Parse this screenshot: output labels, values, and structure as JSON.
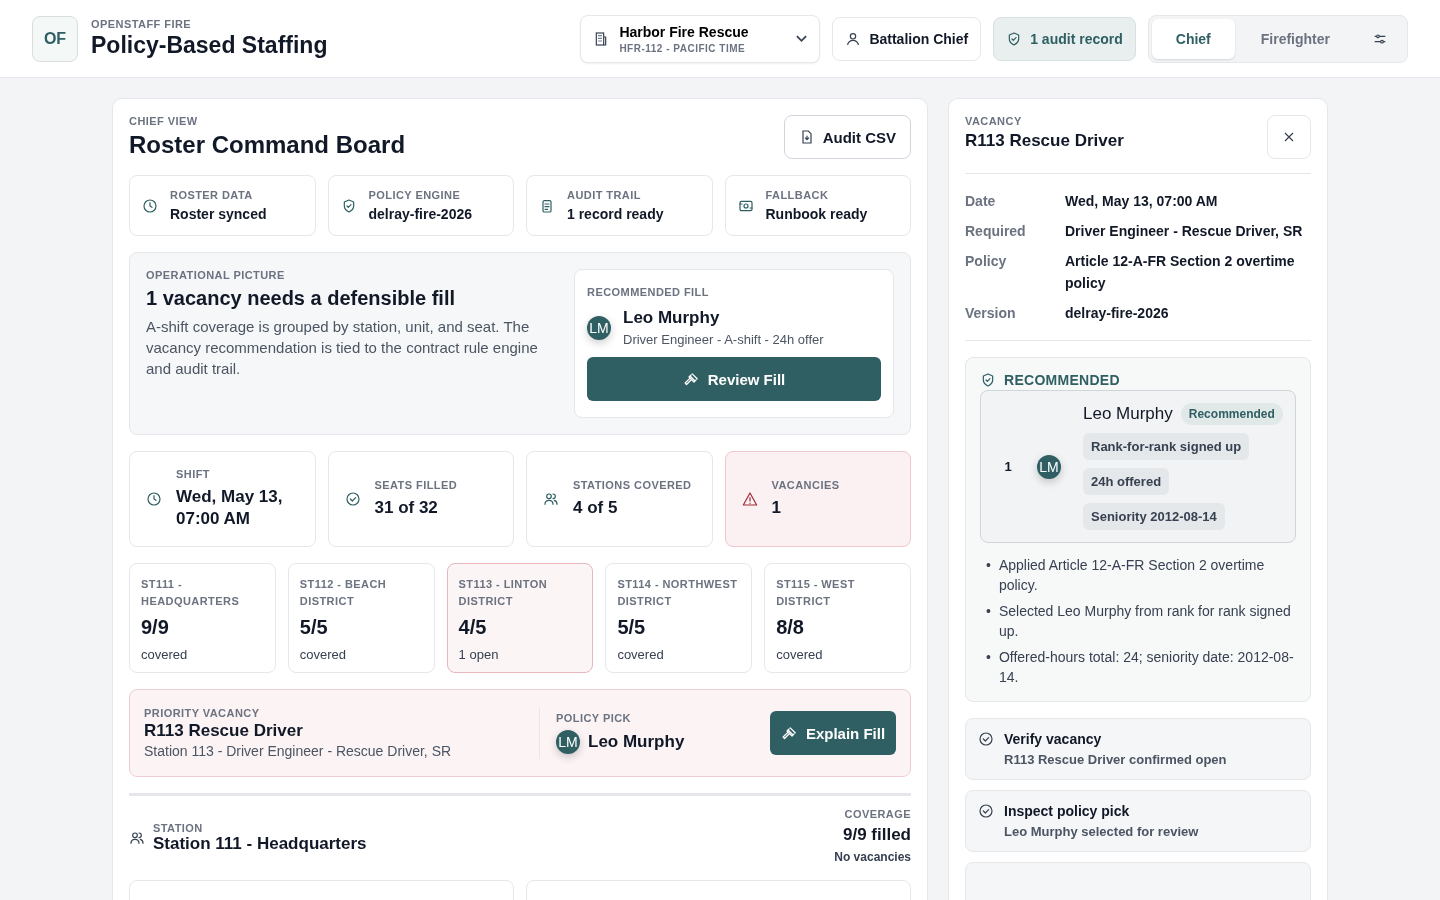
{
  "header": {
    "logo": "OF",
    "org": "OPENSTAFF FIRE",
    "title": "Policy-Based Staffing",
    "agency": {
      "name": "Harbor Fire Rescue",
      "sub": "HFR-112 - PACIFIC TIME"
    },
    "role": "Battalion Chief",
    "audit": "1 audit record",
    "views": [
      {
        "label": "Chief",
        "selected": true
      },
      {
        "label": "Firefighter",
        "selected": false
      }
    ]
  },
  "board": {
    "eyebrow": "CHIEF VIEW",
    "title": "Roster Command Board",
    "export": "Audit CSV",
    "status": [
      {
        "kind": "clock",
        "label": "ROSTER DATA",
        "value": "Roster synced"
      },
      {
        "kind": "shield",
        "label": "POLICY ENGINE",
        "value": "delray-fire-2026"
      },
      {
        "kind": "clipboard",
        "label": "AUDIT TRAIL",
        "value": "1 record ready"
      },
      {
        "kind": "runbook",
        "label": "FALLBACK",
        "value": "Runbook ready"
      }
    ],
    "operational": {
      "eyebrow": "OPERATIONAL PICTURE",
      "title": "1 vacancy needs a defensible fill",
      "body": "A-shift coverage is grouped by station, unit, and seat. The vacancy recommendation is tied to the contract rule engine and audit trail.",
      "recommended": {
        "eyebrow": "RECOMMENDED FILL",
        "initials": "LM",
        "name": "Leo Murphy",
        "detail": "Driver Engineer - A-shift - 24h offer",
        "action": "Review Fill"
      }
    },
    "metrics": [
      {
        "kind": "clock",
        "label": "SHIFT",
        "value": "Wed, May 13, 07:00 AM",
        "alert": false
      },
      {
        "kind": "check",
        "label": "SEATS FILLED",
        "value": "31 of 32",
        "alert": false
      },
      {
        "kind": "people",
        "label": "STATIONS COVERED",
        "value": "4 of 5",
        "alert": false
      },
      {
        "kind": "warning",
        "label": "VACANCIES",
        "value": "1",
        "alert": true
      }
    ],
    "stations": [
      {
        "name": "ST111 - HEADQUARTERS",
        "count": "9/9",
        "note": "covered",
        "alert": false
      },
      {
        "name": "ST112 - BEACH DISTRICT",
        "count": "5/5",
        "note": "covered",
        "alert": false
      },
      {
        "name": "ST113 - LINTON DISTRICT",
        "count": "4/5",
        "note": "1 open",
        "alert": true
      },
      {
        "name": "ST114 - NORTHWEST DISTRICT",
        "count": "5/5",
        "note": "covered",
        "alert": false
      },
      {
        "name": "ST115 - WEST DISTRICT",
        "count": "8/8",
        "note": "covered",
        "alert": false
      }
    ],
    "priority": {
      "eyebrow": "PRIORITY VACANCY",
      "title": "R113 Rescue Driver",
      "detail": "Station 113 - Driver Engineer - Rescue Driver, SR",
      "pick_label": "POLICY PICK",
      "initials": "LM",
      "name": "Leo Murphy",
      "action": "Explain Fill"
    },
    "station_section": {
      "eyebrow": "STATION",
      "title": "Station 111 - Headquarters",
      "coverage_label": "COVERAGE",
      "coverage": "9/9 filled",
      "note": "No vacancies"
    }
  },
  "panel": {
    "eyebrow": "VACANCY",
    "title": "R113 Rescue Driver",
    "details": [
      {
        "label": "Date",
        "value": "Wed, May 13, 07:00 AM"
      },
      {
        "label": "Required",
        "value": "Driver Engineer - Rescue Driver, SR"
      },
      {
        "label": "Policy",
        "value": "Article 12-A-FR Section 2 overtime policy"
      },
      {
        "label": "Version",
        "value": "delray-fire-2026"
      }
    ],
    "recommended": {
      "heading": "RECOMMENDED",
      "rank": "1",
      "initials": "LM",
      "name": "Leo Murphy",
      "badge": "Recommended",
      "tags": [
        "Rank-for-rank signed up",
        "24h offered",
        "Seniority 2012-08-14"
      ],
      "reasons": [
        {
          "bullet": "•",
          "text": "Applied Article 12-A-FR Section 2 overtime policy."
        },
        {
          "bullet": "•",
          "text": "Selected Leo Murphy from rank for rank signed up."
        },
        {
          "bullet": "•",
          "text": "Offered-hours total: 24; seniority date: 2012-08-14."
        }
      ]
    },
    "steps": [
      {
        "title": "Verify vacancy",
        "detail": "R113 Rescue Driver confirmed open"
      },
      {
        "title": "Inspect policy pick",
        "detail": "Leo Murphy selected for review"
      }
    ]
  }
}
